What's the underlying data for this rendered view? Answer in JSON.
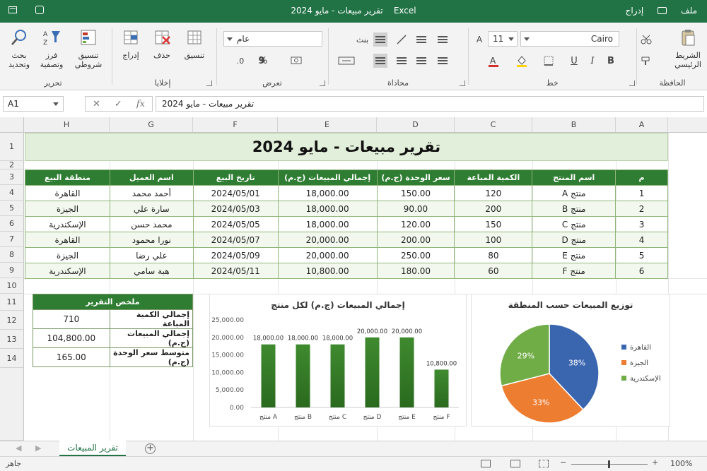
{
  "window": {
    "title": "تقرير مبيعات - مايو 2024",
    "app": "Excel",
    "menu_file": "ملف",
    "menu_insert": "إدراج"
  },
  "ribbon": {
    "clipboard": {
      "group": "الحافظة",
      "paste": "الشريط الرئيسي"
    },
    "font": {
      "group": "خط",
      "name": "Cairo",
      "size": "11",
      "bold": "B",
      "italic": "I",
      "underline": "U"
    },
    "alignment": {
      "group": "محاذاة",
      "wrap": "بنث"
    },
    "number": {
      "group": "تعرض",
      "format": "عام",
      "percent": "%",
      "comma": "9"
    },
    "cells": {
      "group": "إخلايا",
      "insert": "إدراج",
      "delete": "حذف",
      "format": "تنسيق"
    },
    "styles": {
      "conditional": "تنسيق شروطي"
    },
    "editing": {
      "group": "تحرير",
      "sort": "فرز وتصفية",
      "find": "بحث وتحديد"
    }
  },
  "formula_bar": {
    "name_box": "A1",
    "fx": "fx",
    "value": "تقرير مبيعات - مايو 2024"
  },
  "columns": [
    "A",
    "B",
    "C",
    "D",
    "E",
    "F",
    "G",
    "H"
  ],
  "rows": [
    "1",
    "2",
    "3",
    "4",
    "5",
    "6",
    "7",
    "8",
    "9",
    "10",
    "11",
    "12",
    "13",
    "14"
  ],
  "sheet": {
    "title": "تقرير مبيعات - مايو 2024",
    "headers": [
      "م",
      "اسم المنتج",
      "الكمية المباعة",
      "سعر الوحدة (ج.م)",
      "إجمالي المبيعات (ج.م)",
      "تاريخ البيع",
      "اسم العميل",
      "منطقة البيع"
    ],
    "rows": [
      [
        "1",
        "منتج A",
        "120",
        "150.00",
        "18,000.00",
        "2024/05/01",
        "أحمد محمد",
        "القاهرة"
      ],
      [
        "2",
        "منتج B",
        "200",
        "90.00",
        "18,000.00",
        "2024/05/03",
        "سارة علي",
        "الجيزة"
      ],
      [
        "3",
        "منتج C",
        "150",
        "120.00",
        "18,000.00",
        "2024/05/05",
        "محمد حسن",
        "الإسكندرية"
      ],
      [
        "4",
        "منتج D",
        "100",
        "200.00",
        "20,000.00",
        "2024/05/07",
        "نورا محمود",
        "القاهرة"
      ],
      [
        "5",
        "منتج E",
        "80",
        "250.00",
        "20,000.00",
        "2024/05/09",
        "علي رضا",
        "الجيزة"
      ],
      [
        "6",
        "منتج F",
        "60",
        "180.00",
        "10,800.00",
        "2024/05/11",
        "هبة سامي",
        "الإسكندرية"
      ]
    ]
  },
  "summary": {
    "title": "ملخص التقرير",
    "items": [
      {
        "label": "إجمالي الكمية المباعة",
        "value": "710"
      },
      {
        "label": "إجمالي المبيعات (ج.م)",
        "value": "104,800.00"
      },
      {
        "label": "متوسط سعر الوحدة (ج.م)",
        "value": "165.00"
      }
    ]
  },
  "chart_data": [
    {
      "type": "bar",
      "title": "إجمالي المبيعات (ج.م) لكل منتج",
      "categories": [
        "منتج A",
        "منتج B",
        "منتج C",
        "منتج D",
        "منتج E",
        "منتج F"
      ],
      "values": [
        18000,
        18000,
        18000,
        20000,
        20000,
        10800
      ],
      "data_labels": [
        "18,000.00",
        "18,000.00",
        "18,000.00",
        "20,000.00",
        "20,000.00",
        "10,800.00"
      ],
      "yticks": [
        "0.00",
        "5,000.00",
        "10,000.00",
        "15,000.00",
        "20,000.00",
        "25,000.00"
      ],
      "ylim": [
        0,
        25000
      ],
      "color": "#3f8a2f"
    },
    {
      "type": "pie",
      "title": "توزيع المبيعات حسب المنطقة",
      "categories": [
        "القاهرة",
        "الجيزة",
        "الإسكندرية"
      ],
      "values": [
        38,
        33,
        29
      ],
      "labels": [
        "38%",
        "33%",
        "29%"
      ],
      "colors": [
        "#3a66b0",
        "#ed7d31",
        "#70ad47"
      ],
      "legend": "right"
    }
  ],
  "tabs": {
    "sheet": "تقرير المبيعات"
  },
  "status": {
    "ready": "جاهز",
    "zoom": "100%"
  }
}
